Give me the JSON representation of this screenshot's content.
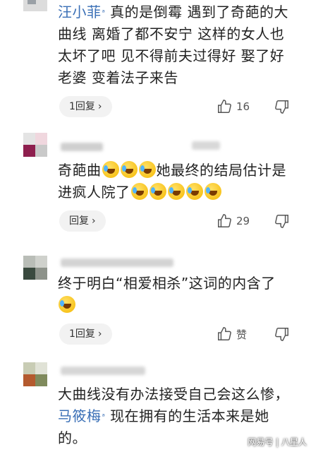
{
  "comments": [
    {
      "mention": "汪小菲",
      "mention_badge": "ᵃ",
      "text": "真的是倒霉 遇到了奇葩的大曲线 离婚了都不安宁 这样的女人也太坏了吧 见不得前夫过得好 娶了好老婆 变着法子来告",
      "reply_label": "1回复",
      "reply_chevron": "›",
      "likes": "16"
    },
    {
      "text": "奇葩曲",
      "text_tail_1": "她最终的结局估计是进疯人院了",
      "reply_label": "回复",
      "reply_chevron": "›",
      "likes": "29"
    },
    {
      "text": "终于明白“相爱相杀”这词的内含了",
      "reply_label": "1回复",
      "reply_chevron": "›",
      "likes": "赞"
    },
    {
      "text_pre": "大曲线没有办法接受自己会这么惨，",
      "mention": "马筱梅",
      "mention_badge": "ᵃ",
      "text_post": "现在拥有的生活本来是她的。"
    }
  ],
  "icons": {
    "like": "thumbs-up-icon",
    "dislike": "thumbs-down-icon",
    "emoji": "crying-laughing-emoji-icon"
  },
  "colors": {
    "mention": "#3a6fb6",
    "button_bg": "#f2f2f2"
  },
  "watermark": "网易号 | 八星人"
}
